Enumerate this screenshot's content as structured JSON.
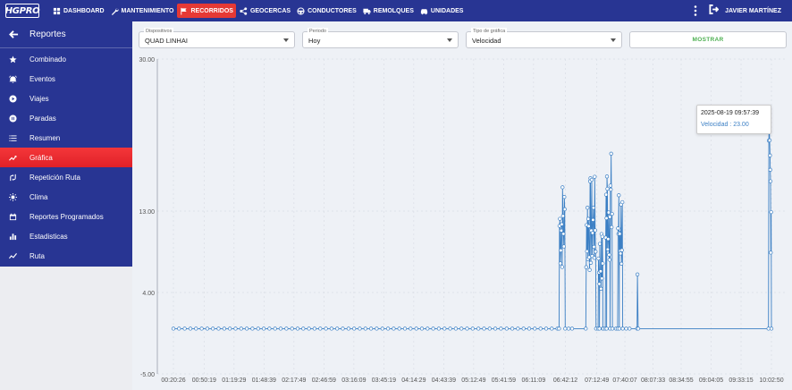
{
  "logo": "HGPRO",
  "nav": [
    {
      "label": "DASHBOARD",
      "icon": "dashboard-icon",
      "active": false
    },
    {
      "label": "MANTENIMIENTO",
      "icon": "wrench-icon",
      "active": false
    },
    {
      "label": "RECORRIDOS",
      "icon": "flag-icon",
      "active": true
    },
    {
      "label": "GEOCERCAS",
      "icon": "share-icon",
      "active": false
    },
    {
      "label": "CONDUCTORES",
      "icon": "steering-wheel-icon",
      "active": false
    },
    {
      "label": "REMOLQUES",
      "icon": "truck-icon",
      "active": false
    },
    {
      "label": "UNIDADES",
      "icon": "car-icon",
      "active": false
    }
  ],
  "user": {
    "name": "JAVIER MARTÍNEZ"
  },
  "sidebar": {
    "title": "Reportes",
    "items": [
      {
        "label": "Combinado",
        "icon": "star-icon",
        "active": false
      },
      {
        "label": "Eventos",
        "icon": "alarm-icon",
        "active": false
      },
      {
        "label": "Viajes",
        "icon": "play-circle-icon",
        "active": false
      },
      {
        "label": "Paradas",
        "icon": "pause-circle-icon",
        "active": false
      },
      {
        "label": "Resumen",
        "icon": "list-icon",
        "active": false
      },
      {
        "label": "Gráfica",
        "icon": "trending-icon",
        "active": true
      },
      {
        "label": "Repetición Ruta",
        "icon": "route-icon",
        "active": false
      },
      {
        "label": "Clima",
        "icon": "sun-icon",
        "active": false
      },
      {
        "label": "Reportes Programados",
        "icon": "calendar-icon",
        "active": false
      },
      {
        "label": "Estadisticas",
        "icon": "bar-chart-icon",
        "active": false
      },
      {
        "label": "Ruta",
        "icon": "timeline-icon",
        "active": false
      }
    ]
  },
  "filters": {
    "device": {
      "label": "Dispositivos",
      "value": "QUAD LINHAI"
    },
    "period": {
      "label": "Periodo",
      "value": "Hoy"
    },
    "chart_type": {
      "label": "Tipo de gráfica",
      "value": "Velocidad"
    },
    "show_button": "MOSTRAR"
  },
  "tooltip": {
    "time": "2025-08-19 09:57:39",
    "series_text": "Velocidad : 23.00"
  },
  "colors": {
    "primary": "#283593",
    "accent": "#e53935",
    "line": "#3b7fc4",
    "show_button": "#4caf50"
  },
  "chart_data": {
    "type": "line",
    "y_ticks": [
      "30.00",
      "13.00",
      "4.00",
      "-5.00"
    ],
    "x_ticks": [
      "00:20:26",
      "00:50:19",
      "01:19:29",
      "01:48:39",
      "02:17:49",
      "02:46:59",
      "03:16:09",
      "03:45:19",
      "04:14:29",
      "04:43:39",
      "05:12:49",
      "05:41:59",
      "06:11:09",
      "06:42:12",
      "07:12:49",
      "07:40:07",
      "08:07:33",
      "08:34:55",
      "09:04:05",
      "09:33:15",
      "10:02:50"
    ],
    "ylim": [
      -5,
      30
    ],
    "grid": true,
    "series": [
      {
        "values_desc": "speed samples",
        "segments": [
          {
            "from": "00:20:26",
            "to": "06:36:00",
            "value": 0
          },
          {
            "from": "06:36:00",
            "to": "06:42:00",
            "value_range": [
              0,
              17.0
            ]
          },
          {
            "from": "07:02:00",
            "to": "07:12:00",
            "value_range": [
              0,
              17.0
            ]
          },
          {
            "from": "07:14:00",
            "to": "07:19:00",
            "value_range": [
              0,
              11.0
            ]
          },
          {
            "from": "07:21:00",
            "to": "07:28:00",
            "value_range": [
              0,
              20.0
            ]
          },
          {
            "from": "07:33:00",
            "to": "07:38:00",
            "value_range": [
              0,
              16.5
            ]
          },
          {
            "from": "07:52:00",
            "to": "07:53:00",
            "value": 6.0
          },
          {
            "from": "10:00:00",
            "to": "10:02:50",
            "value_range": [
              0,
              23.0
            ]
          }
        ]
      }
    ]
  }
}
